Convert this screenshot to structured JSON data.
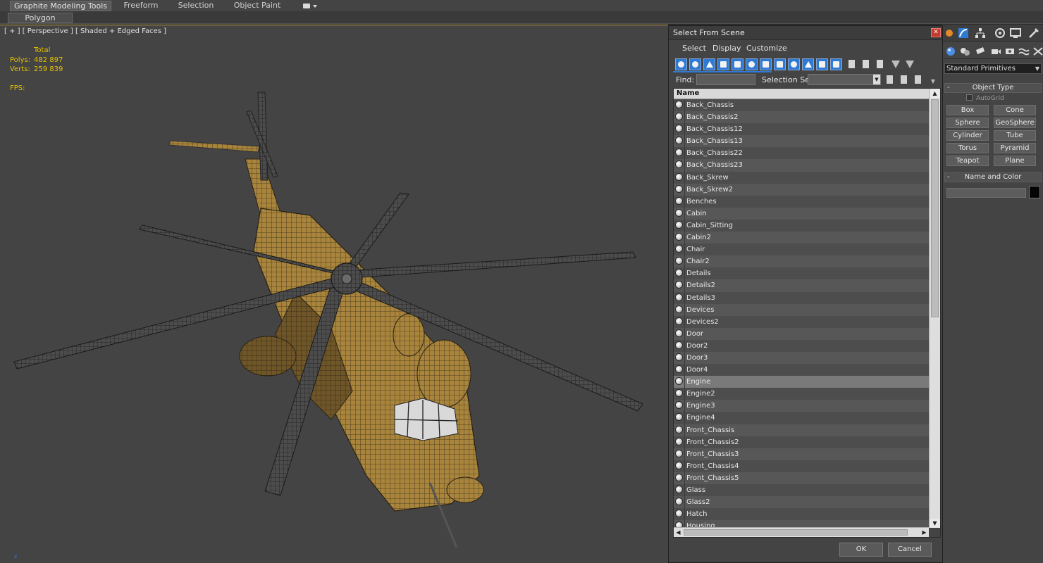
{
  "ribbon": {
    "tabs": [
      "Graphite Modeling Tools",
      "Freeform",
      "Selection",
      "Object Paint"
    ],
    "active_tab": "Graphite Modeling Tools",
    "sub_tab": "Polygon Modeling"
  },
  "viewport": {
    "label": "[ + ] [ Perspective ] [ Shaded + Edged Faces ]",
    "stats": {
      "header": "Total",
      "polys_label": "Polys:",
      "polys_value": "482 897",
      "verts_label": "Verts:",
      "verts_value": "259 839",
      "fps_label": "FPS:"
    },
    "axis_label": "z"
  },
  "dialog": {
    "title": "Select From Scene",
    "menu": [
      "Select",
      "Display",
      "Customize"
    ],
    "find_label": "Find:",
    "find_value": "",
    "selection_set_label": "Selection Set:",
    "selection_set_value": "",
    "column_header": "Name",
    "objects": [
      "Back_Chassis",
      "Back_Chassis2",
      "Back_Chassis12",
      "Back_Chassis13",
      "Back_Chassis22",
      "Back_Chassis23",
      "Back_Skrew",
      "Back_Skrew2",
      "Benches",
      "Cabin",
      "Cabin_Sitting",
      "Cabin2",
      "Chair",
      "Chair2",
      "Details",
      "Details2",
      "Details3",
      "Devices",
      "Devices2",
      "Door",
      "Door2",
      "Door3",
      "Door4",
      "Engine",
      "Engine2",
      "Engine3",
      "Engine4",
      "Front_Chassis",
      "Front_Chassis2",
      "Front_Chassis3",
      "Front_Chassis4",
      "Front_Chassis5",
      "Glass",
      "Glass2",
      "Hatch",
      "Housing"
    ],
    "selected_object": "Engine",
    "ok_label": "OK",
    "cancel_label": "Cancel"
  },
  "command_panel": {
    "category_dropdown": "Standard Primitives",
    "object_type_rollout": "Object Type",
    "autogrid_label": "AutoGrid",
    "primitives": [
      "Box",
      "Cone",
      "Sphere",
      "GeoSphere",
      "Cylinder",
      "Tube",
      "Torus",
      "Pyramid",
      "Teapot",
      "Plane"
    ],
    "name_color_rollout": "Name and Color",
    "name_value": "",
    "color_swatch": "#050505"
  },
  "colors": {
    "accent_blue": "#2e7ad4",
    "stats_yellow": "#e6c000",
    "viewport_bg": "#444444",
    "close_red": "#c23b2e"
  }
}
